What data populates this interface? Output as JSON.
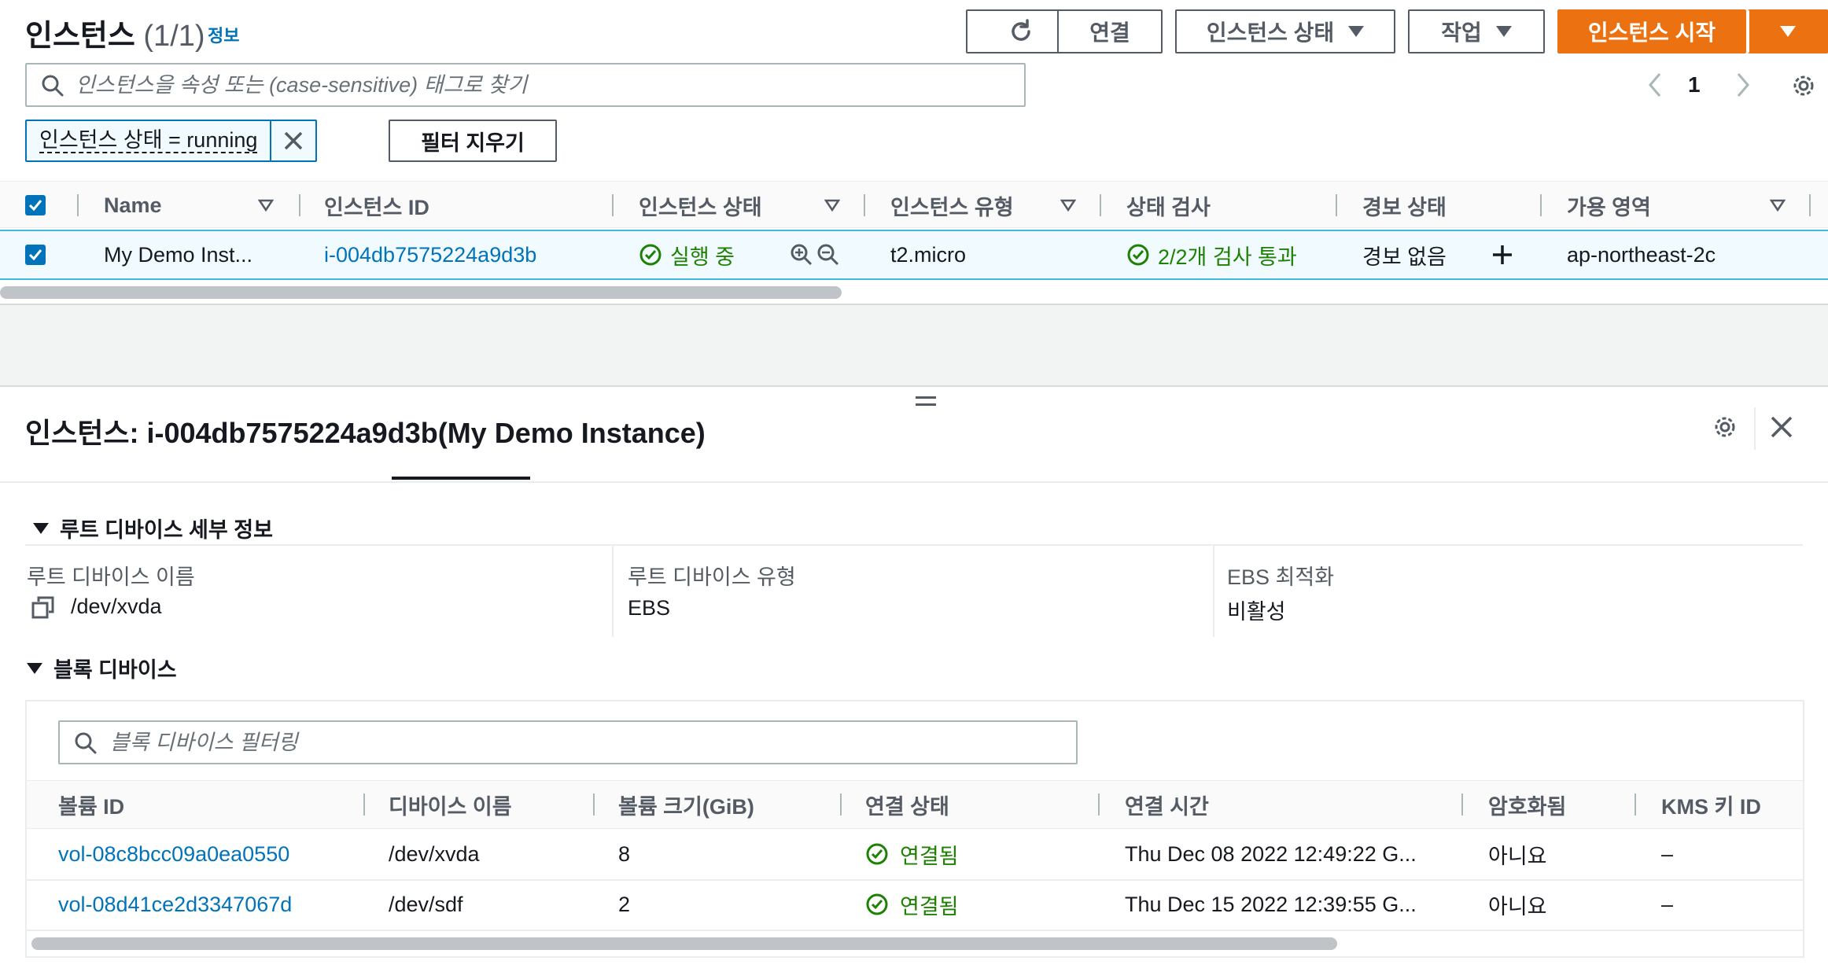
{
  "header": {
    "title": "인스턴스",
    "count": "(1/1)",
    "info_link": "정보",
    "buttons": {
      "refresh_icon": "refresh-icon",
      "connect": "연결",
      "instance_state": "인스턴스 상태",
      "actions": "작업",
      "launch": "인스턴스 시작"
    }
  },
  "search": {
    "placeholder": "인스턴스을 속성 또는 (case-sensitive) 태그로 찾기"
  },
  "pagination": {
    "page": "1"
  },
  "filter": {
    "token": "인스턴스 상태 = running",
    "clear_label": "필터 지우기"
  },
  "instances_table": {
    "columns": [
      "Name",
      "인스턴스 ID",
      "인스턴스 상태",
      "인스턴스 유형",
      "상태 검사",
      "경보 상태",
      "가용 영역"
    ],
    "rows": [
      {
        "name": "My Demo Inst...",
        "instance_id": "i-004db7575224a9d3b",
        "state": "실행 중",
        "type": "t2.micro",
        "status_check": "2/2개 검사 통과",
        "alarm": "경보 없음",
        "az": "ap-northeast-2c"
      }
    ]
  },
  "detail": {
    "title": "인스턴스: i-004db7575224a9d3b(My Demo Instance)",
    "root_section": {
      "title": "루트 디바이스 세부 정보",
      "device_name_label": "루트 디바이스 이름",
      "device_name_value": "/dev/xvda",
      "device_type_label": "루트 디바이스 유형",
      "device_type_value": "EBS",
      "ebs_opt_label": "EBS 최적화",
      "ebs_opt_value": "비활성"
    },
    "block_section": {
      "title": "블록 디바이스",
      "search_placeholder": "블록 디바이스 필터링",
      "columns": [
        "볼륨 ID",
        "디바이스 이름",
        "볼륨 크기(GiB)",
        "연결 상태",
        "연결 시간",
        "암호화됨",
        "KMS 키 ID"
      ],
      "rows": [
        {
          "volume_id": "vol-08c8bcc09a0ea0550",
          "device": "/dev/xvda",
          "size": "8",
          "status": "연결됨",
          "time": "Thu Dec 08 2022 12:49:22 G...",
          "encrypted": "아니요",
          "kms": "–"
        },
        {
          "volume_id": "vol-08d41ce2d3347067d",
          "device": "/dev/sdf",
          "size": "2",
          "status": "연결됨",
          "time": "Thu Dec 15 2022 12:39:55 G...",
          "encrypted": "아니요",
          "kms": "–"
        }
      ]
    }
  },
  "colors": {
    "primary": "#ec7211",
    "link": "#0073bb",
    "success": "#1d8102",
    "border": "#545b64"
  }
}
